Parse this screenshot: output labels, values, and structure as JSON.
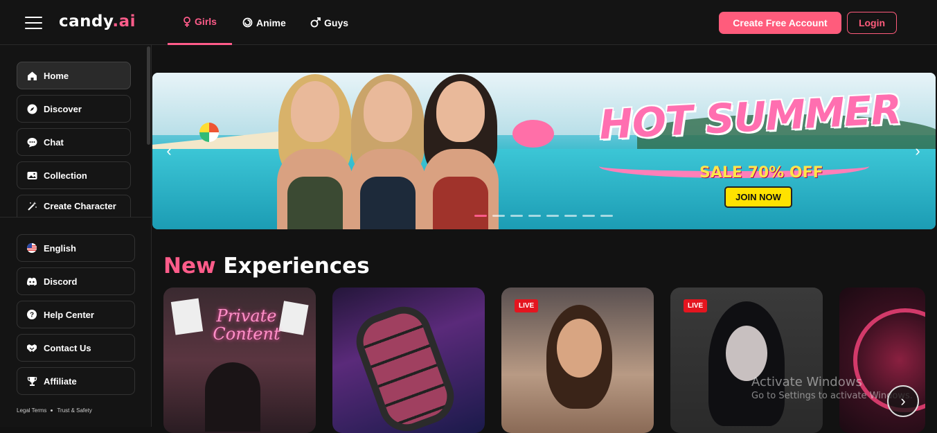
{
  "header": {
    "logo_main": "candy",
    "logo_dot": ".",
    "logo_tld": "ai",
    "tabs": [
      {
        "label": "Girls",
        "icon": "female-symbol-icon",
        "active": true
      },
      {
        "label": "Anime",
        "icon": "swirl-icon",
        "active": false
      },
      {
        "label": "Guys",
        "icon": "male-symbol-icon",
        "active": false
      }
    ],
    "create_account_label": "Create Free Account",
    "login_label": "Login"
  },
  "sidebar": {
    "items": [
      {
        "label": "Home",
        "icon": "home-icon",
        "active": true
      },
      {
        "label": "Discover",
        "icon": "compass-icon"
      },
      {
        "label": "Chat",
        "icon": "chat-bubble-icon"
      },
      {
        "label": "Collection",
        "icon": "image-gallery-icon"
      },
      {
        "label": "Create Character",
        "icon": "magic-wand-icon"
      }
    ],
    "bottom_items": [
      {
        "label": "English",
        "icon": "us-flag-icon"
      },
      {
        "label": "Discord",
        "icon": "discord-icon"
      },
      {
        "label": "Help Center",
        "icon": "help-circle-icon"
      },
      {
        "label": "Contact Us",
        "icon": "handshake-icon"
      },
      {
        "label": "Affiliate",
        "icon": "trophy-icon"
      }
    ],
    "legal_terms": "Legal Terms",
    "trust_safety": "Trust & Safety"
  },
  "banner": {
    "headline": "HOT SUMMER",
    "sale_text": "SALE 70% OFF",
    "cta_label": "JOIN NOW",
    "slide_count": 8,
    "active_slide": 1,
    "prev_arrow": "‹",
    "next_arrow": "›"
  },
  "section": {
    "title_accent": "New",
    "title_rest": "Experiences"
  },
  "cards": [
    {
      "overlay_text_line1": "Private",
      "overlay_text_line2": "Content",
      "live": false
    },
    {
      "live": false
    },
    {
      "live": true,
      "badge": "LIVE"
    },
    {
      "live": true,
      "badge": "LIVE"
    },
    {
      "live": false
    }
  ],
  "next_button": "›",
  "watermark": {
    "line1": "Activate Windows",
    "line2": "Go to Settings to activate Windows."
  },
  "colors": {
    "accent": "#ff5c8a",
    "button": "#ff5c7c",
    "background": "#121212",
    "live_badge": "#e4151f",
    "cta_yellow": "#ffe200"
  }
}
